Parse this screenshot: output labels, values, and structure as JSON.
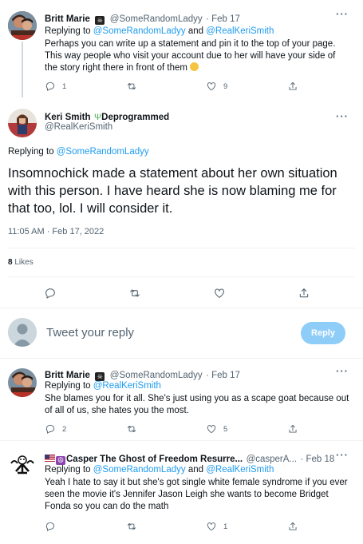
{
  "tweets": [
    {
      "name": "Britt Marie",
      "handle": "@SomeRandomLadyy",
      "time": "· Feb 17",
      "reply_prefix": "",
      "reply_to": "",
      "text": "Perhaps you can write up a statement and pin it to the top of your page. This way people who visit your account due to her will have your side of the story right there in front of them",
      "replies": "1",
      "retweets": "",
      "likes": "9"
    }
  ],
  "main_tweet": {
    "name": "Keri Smith",
    "badge": "Deprogrammed",
    "handle": "@RealKeriSmith",
    "reply_prefix": "Replying to",
    "reply_to": "@SomeRandomLadyy",
    "text": "Insomnochick made a statement about her own situation with this person. I have heard she is now blaming me for that too, lol. I will consider it.",
    "timestamp": "11:05 AM · Feb 17, 2022",
    "likes_count": "8",
    "likes_label": "Likes"
  },
  "reply_box": {
    "placeholder": "Tweet your reply",
    "button": "Reply"
  },
  "replies": [
    {
      "name": "Britt Marie",
      "handle": "@SomeRandomLadyy",
      "time": "· Feb 17",
      "reply_prefix": "Replying to",
      "reply_to": "@RealKeriSmith",
      "text": "She blames you for it all. She's just using you as a scape goat because out of all of us, she hates you the most.",
      "replies": "2",
      "likes": "5"
    },
    {
      "name": "Casper The Ghost of Freedom Resurre...",
      "handle": "@casperA...",
      "time": "· Feb 18",
      "reply_prefix": "Replying to",
      "reply_to_1": "@SomeRandomLadyy",
      "and": "and",
      "reply_to_2": "@RealKeriSmith",
      "text": "Yeah I hate to say it but she's got single white female syndrome if you ever seen the movie it's Jennifer Jason Leigh she wants to become Bridget Fonda so you can do the math",
      "likes": "1"
    }
  ],
  "first_reply_line": {
    "prefix": "Replying to",
    "to_1": "@SomeRandomLadyy",
    "and": "and",
    "to_2": "@RealKeriSmith"
  },
  "colors": {
    "accent": "#1d9bf0",
    "muted": "#536471",
    "text": "#0f1419",
    "reply_button_bg": "#8ecdf8"
  }
}
